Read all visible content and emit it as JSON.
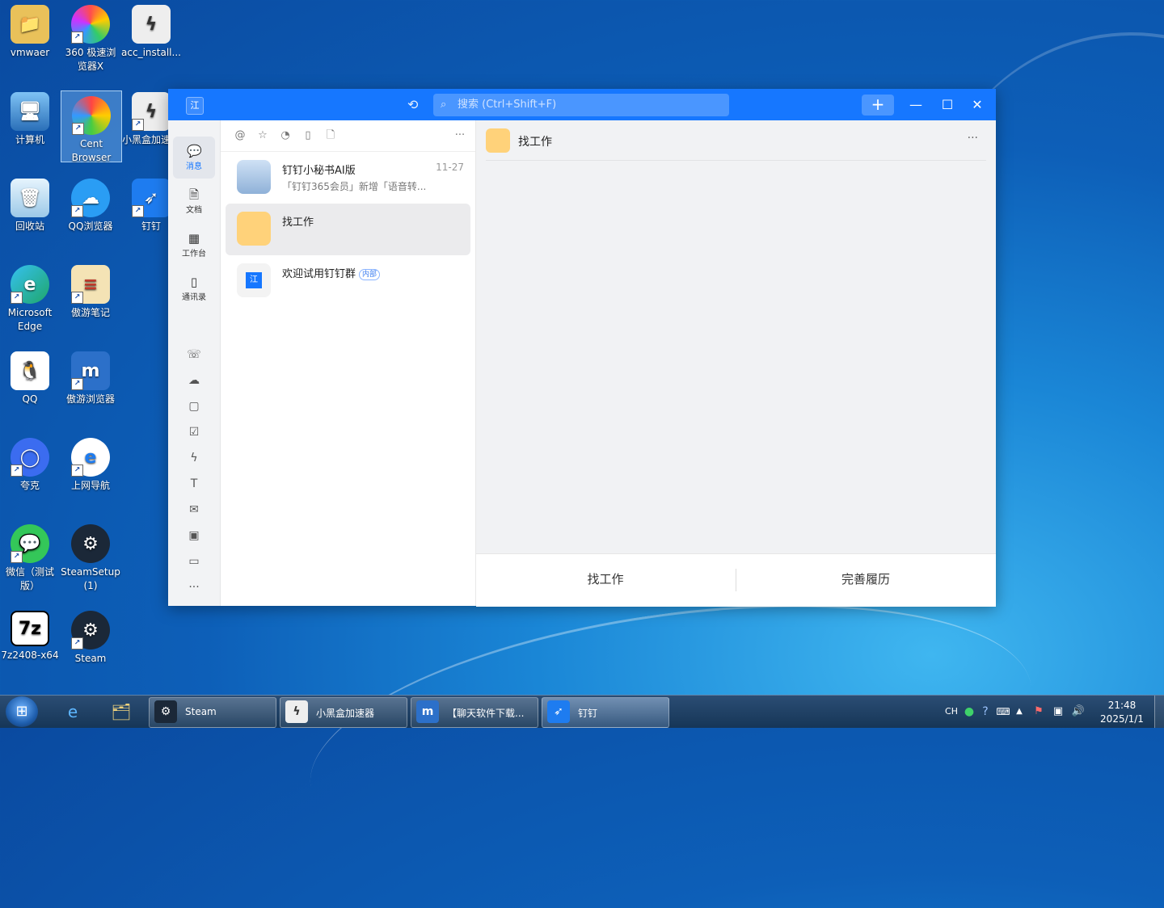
{
  "desktop": {
    "icons": [
      {
        "label": "vmwaer",
        "icon": "folder-user-icon",
        "color": "#e9c15a"
      },
      {
        "label": "360 极速浏览器X",
        "icon": "browser-360-icon",
        "color": "#ff6a3d"
      },
      {
        "label": "acc_install...",
        "icon": "lightning-shield-icon",
        "color": "#e8e8e8"
      },
      {
        "label": "计算机",
        "icon": "computer-icon",
        "color": "#3a8fd9"
      },
      {
        "label": "Cent Browser",
        "icon": "cent-browser-icon",
        "color": "#2e88e0"
      },
      {
        "label": "小黑盒加速器",
        "icon": "lightning-accelerator-icon",
        "color": "#e8e8e8"
      },
      {
        "label": "回收站",
        "icon": "recycle-bin-icon",
        "color": "#bfe0f5"
      },
      {
        "label": "QQ浏览器",
        "icon": "qq-browser-icon",
        "color": "#2a9df4"
      },
      {
        "label": "钉钉",
        "icon": "dingtalk-icon",
        "color": "#1e7cf0"
      },
      {
        "label": "Microsoft Edge",
        "icon": "edge-icon",
        "color": "#1fa6a3"
      },
      {
        "label": "傲游笔记",
        "icon": "notes-icon",
        "color": "#f4e3b5"
      },
      {
        "label": "QQ",
        "icon": "qq-penguin-icon",
        "color": "#ffffff"
      },
      {
        "label": "傲游浏览器",
        "icon": "maxthon-icon",
        "color": "#2c70c9"
      },
      {
        "label": "夸克",
        "icon": "quark-icon",
        "color": "#3b6cf0"
      },
      {
        "label": "上网导航",
        "icon": "ie-icon",
        "color": "#ffffff"
      },
      {
        "label": "微信（测试版）",
        "icon": "wechat-icon",
        "color": "#34c759"
      },
      {
        "label": "SteamSetup (1)",
        "icon": "steam-setup-icon",
        "color": "#1b2838"
      },
      {
        "label": "7z2408-x64",
        "icon": "7zip-icon",
        "color": "#ffffff"
      },
      {
        "label": "Steam",
        "icon": "steam-icon",
        "color": "#1b2838"
      }
    ]
  },
  "app": {
    "title_avatar": "江",
    "search_placeholder": "搜索 (Ctrl+Shift+F)",
    "nav": [
      {
        "label": "消息",
        "icon": "message-icon"
      },
      {
        "label": "文档",
        "icon": "document-icon"
      },
      {
        "label": "工作台",
        "icon": "workbench-icon"
      },
      {
        "label": "通讯录",
        "icon": "contacts-icon"
      }
    ],
    "nav_small_icons": [
      "phone-icon",
      "cloud-icon",
      "calendar-icon",
      "todo-icon",
      "lightning-icon",
      "text-format-icon",
      "mail-icon",
      "notebook-icon",
      "folder-icon",
      "more-icon"
    ],
    "filter_icons": [
      "at-icon",
      "star-icon",
      "clock-icon",
      "bookmark-icon",
      "file-icon"
    ],
    "conversations": [
      {
        "name": "钉钉小秘书AI版",
        "preview": "「钉钉365会员」新增「语音转...",
        "time": "11-27",
        "tag": ""
      },
      {
        "name": "找工作",
        "preview": "",
        "time": "",
        "tag": ""
      },
      {
        "name": "欢迎试用钉钉群",
        "preview": "",
        "time": "",
        "tag": "内部"
      }
    ],
    "chat": {
      "title": "找工作",
      "more": "···",
      "footer_buttons": [
        "找工作",
        "完善履历"
      ]
    },
    "accent": "#1677ff"
  },
  "taskbar": {
    "tasks": [
      {
        "label": "Steam",
        "icon": "steam-icon"
      },
      {
        "label": "小黑盒加速器",
        "icon": "lightning-accelerator-icon"
      },
      {
        "label": "【聊天软件下载...",
        "icon": "maxthon-icon"
      },
      {
        "label": "钉钉",
        "icon": "dingtalk-icon"
      }
    ],
    "lang": "CH",
    "time": "21:48",
    "date": "2025/1/1"
  }
}
